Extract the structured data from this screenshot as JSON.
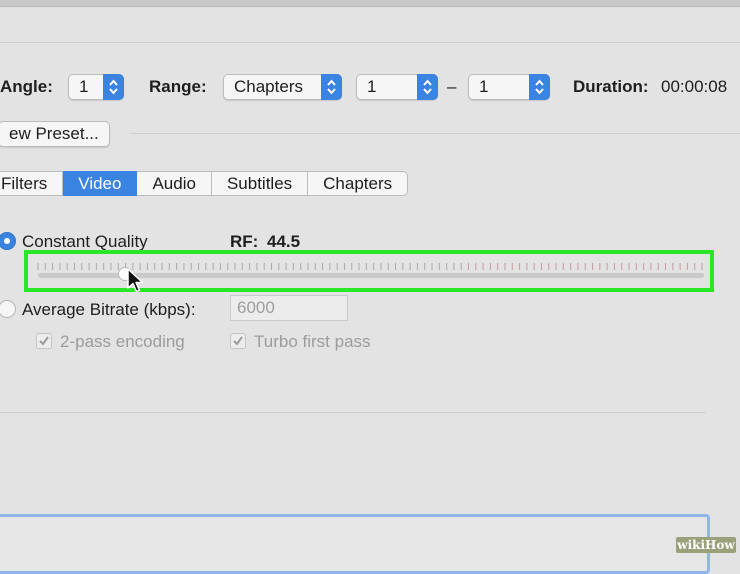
{
  "header": {
    "angle_label": "Angle:",
    "angle_value": "1",
    "range_label": "Range:",
    "range_type": "Chapters",
    "range_start": "1",
    "range_separator": "–",
    "range_end": "1",
    "duration_label": "Duration:",
    "duration_value": "00:00:08"
  },
  "preset": {
    "button_label": "ew Preset..."
  },
  "tabs": [
    {
      "label": "Filters",
      "active": false
    },
    {
      "label": "Video",
      "active": true
    },
    {
      "label": "Audio",
      "active": false
    },
    {
      "label": "Subtitles",
      "active": false
    },
    {
      "label": "Chapters",
      "active": false
    }
  ],
  "quality": {
    "constant_quality_label": "Constant Quality",
    "constant_quality_selected": true,
    "rf_label": "RF:",
    "rf_value": "44.5",
    "slider_position_fraction": 0.13,
    "average_bitrate_label": "Average Bitrate (kbps):",
    "average_bitrate_selected": false,
    "bitrate_value": "6000",
    "two_pass_label": "2-pass encoding",
    "two_pass_checked": true,
    "turbo_label": "Turbo first pass",
    "turbo_checked": true
  },
  "colors": {
    "accent": "#3a83e0",
    "highlight": "#29e629",
    "background": "#e3e3e3"
  },
  "watermark": {
    "text": "wikiHow"
  }
}
